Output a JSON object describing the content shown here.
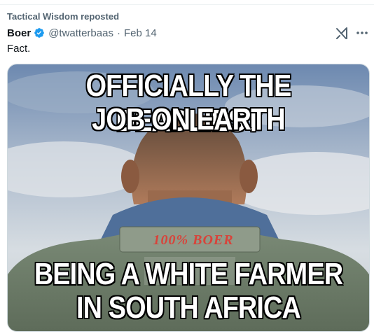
{
  "repost": {
    "text": "Tactical Wisdom reposted"
  },
  "author": {
    "name": "Boer",
    "handle": "@twatterbaas",
    "separator": "·",
    "date": "Feb 14",
    "verified_color": "#1d9bf0"
  },
  "post": {
    "text": "Fact."
  },
  "icons": {
    "grok": "grok-icon",
    "more": "more-options-icon",
    "verified": "verified-badge-icon"
  },
  "media": {
    "top_line_1": "OFFICIALLY THE DEADLIEST",
    "top_line_2": "JOB ON EARTH",
    "patch_text": "100% BOER",
    "bottom_line_1": "BEING A WHITE FARMER",
    "bottom_line_2": "IN SOUTH AFRICA"
  }
}
